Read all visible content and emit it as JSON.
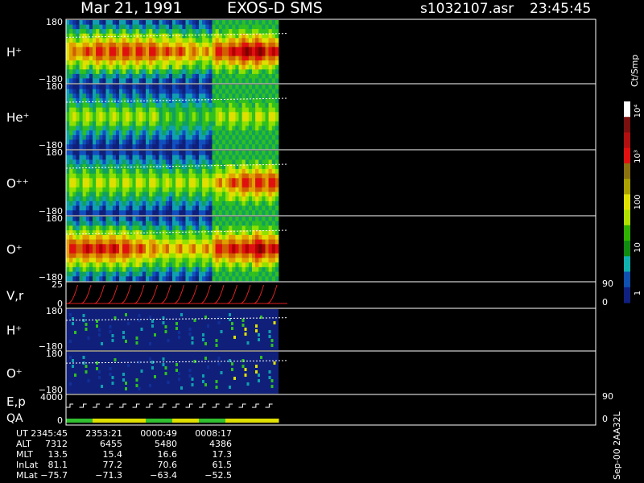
{
  "header": {
    "date": "Mar 21, 1991",
    "instrument": "EXOS-D SMS",
    "file": "s1032107.asr",
    "time": "23:45:45"
  },
  "colorbar": {
    "units": "Ct/Smp",
    "tick_labels": [
      "10⁴",
      "10³",
      "100",
      "10",
      "1"
    ],
    "colors": [
      "#ffffff",
      "#7a1010",
      "#b01010",
      "#e01010",
      "#8a7010",
      "#aaa000",
      "#e0e000",
      "#b0e000",
      "#30b000",
      "#108a10",
      "#10b0b0",
      "#1050b0",
      "#102080"
    ]
  },
  "chart_data": [
    {
      "type": "heatmap",
      "panel": "H+",
      "ylabel": "H⁺",
      "ytick_labels": [
        "180",
        "−180"
      ],
      "ylim": [
        -180,
        180
      ],
      "time_axis": [
        "2345:45",
        "2353:21",
        "0000:49",
        "0008:17"
      ],
      "bursts": 16,
      "peak_level": [
        0.75,
        0.8,
        0.85,
        0.85,
        0.85,
        0.85,
        0.85,
        0.8,
        0.8,
        0.75,
        0.7,
        0.85,
        0.9,
        0.95,
        0.95,
        0.9
      ]
    },
    {
      "type": "heatmap",
      "panel": "He+",
      "ylabel": "He⁺",
      "ytick_labels": [
        "180",
        "−180"
      ],
      "ylim": [
        -180,
        180
      ],
      "bursts": 16,
      "peak_level": [
        0.55,
        0.55,
        0.55,
        0.55,
        0.55,
        0.55,
        0.55,
        0.5,
        0.5,
        0.5,
        0.5,
        0.55,
        0.6,
        0.6,
        0.6,
        0.6
      ]
    },
    {
      "type": "heatmap",
      "panel": "O++",
      "ylabel": "O⁺⁺",
      "ytick_labels": [
        "180",
        "−180"
      ],
      "ylim": [
        -180,
        180
      ],
      "bursts": 16,
      "peak_level": [
        0.6,
        0.6,
        0.6,
        0.6,
        0.6,
        0.6,
        0.6,
        0.55,
        0.6,
        0.6,
        0.6,
        0.7,
        0.8,
        0.85,
        0.85,
        0.85
      ]
    },
    {
      "type": "heatmap",
      "panel": "O+",
      "ylabel": "O⁺",
      "ytick_labels": [
        "180",
        "−180"
      ],
      "ylim": [
        -180,
        180
      ],
      "bursts": 16,
      "peak_level": [
        0.85,
        0.9,
        0.9,
        0.9,
        0.85,
        0.8,
        0.75,
        0.7,
        0.7,
        0.7,
        0.7,
        0.85,
        0.9,
        0.9,
        0.95,
        0.9
      ]
    },
    {
      "type": "line",
      "panel": "V,r",
      "ylabel": "V,r",
      "ytick_labels": [
        "25",
        "0"
      ],
      "ylim": [
        0,
        25
      ],
      "right_tick_labels": [
        "90",
        "0"
      ],
      "sweeps": 16
    },
    {
      "type": "heatmap",
      "panel": "H+ (2)",
      "ylabel": "H⁺",
      "ytick_labels": [
        "180",
        "−180"
      ],
      "ylim": [
        -180,
        180
      ]
    },
    {
      "type": "heatmap",
      "panel": "O+ (2)",
      "ylabel": "O⁺",
      "ytick_labels": [
        "180",
        "−180"
      ],
      "ylim": [
        -180,
        180
      ]
    },
    {
      "type": "line",
      "panel": "E,p / QA",
      "ylabel": "E,p",
      "ylabel2": "QA",
      "ytick_labels": [
        "4000",
        "0"
      ],
      "ylim": [
        0,
        4000
      ],
      "right_tick_labels": [
        "90",
        "0"
      ],
      "steps": 16
    }
  ],
  "table": {
    "rows": [
      {
        "label": "UT",
        "values": [
          "2345:45",
          "2353:21",
          "0000:49",
          "0008:17"
        ]
      },
      {
        "label": "ALT",
        "values": [
          "7312",
          "6455",
          "5480",
          "4386"
        ]
      },
      {
        "label": "MLT",
        "values": [
          "13.5",
          "15.4",
          "16.6",
          "17.3"
        ]
      },
      {
        "label": "InLat",
        "values": [
          "81.1",
          "77.2",
          "70.6",
          "61.5"
        ]
      },
      {
        "label": "MLat",
        "values": [
          "−75.7",
          "−71.3",
          "−63.4",
          "−52.5"
        ]
      }
    ]
  },
  "footer_id": "Sep-00  2AA32L"
}
